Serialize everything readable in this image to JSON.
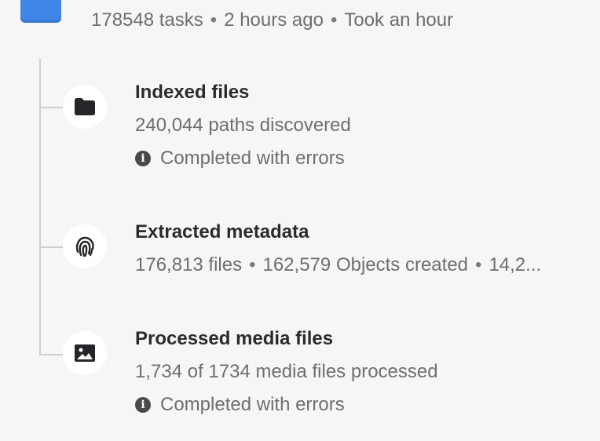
{
  "job": {
    "icon": "folder-icon",
    "tasks": "178548 tasks",
    "time_ago": "2 hours ago",
    "duration": "Took an hour",
    "separator": "•"
  },
  "steps": [
    {
      "icon": "folder-icon",
      "title": "Indexed files",
      "detail": "240,044 paths discovered",
      "status_icon": "info-icon",
      "status": "Completed with errors"
    },
    {
      "icon": "fingerprint-icon",
      "title": "Extracted metadata",
      "detail_parts": [
        "176,813 files",
        "162,579 Objects created",
        "14,2..."
      ]
    },
    {
      "icon": "image-icon",
      "title": "Processed media files",
      "detail": "1,734 of 1734 media files processed",
      "status_icon": "info-icon",
      "status": "Completed with errors"
    }
  ],
  "colors": {
    "background": "#f6f6f6",
    "accent": "#3f86e8",
    "text": "#2b2b2f",
    "secondary_text": "#6e6e73"
  }
}
